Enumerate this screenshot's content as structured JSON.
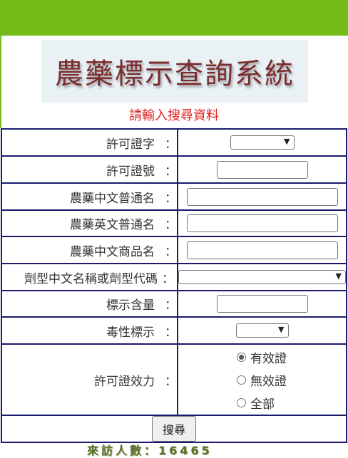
{
  "banner": {
    "title": "農藥標示查詢系統"
  },
  "subtitle": "請輸入搜尋資料",
  "fields": {
    "license_type_label": "許可證字",
    "license_no_label": "許可證號",
    "cn_common_name_label": "農藥中文普通名",
    "en_common_name_label": "農藥英文普通名",
    "cn_product_name_label": "農藥中文商品名",
    "formulation_label": "劑型中文名稱或劑型代碼",
    "content_label": "標示含量",
    "toxicity_label": "毒性標示",
    "validity_label": "許可證效力",
    "colon": "："
  },
  "validity_options": [
    "有效證",
    "無效證",
    "全部"
  ],
  "validity_selected": "有效證",
  "search_button": "搜尋",
  "counter": {
    "label": "來訪人數：",
    "value": "16465"
  },
  "colors": {
    "topbar": "#74bb1a",
    "table_border": "#1a1a6e",
    "subtitle": "#e02020",
    "banner_text": "#7b2c2c"
  }
}
